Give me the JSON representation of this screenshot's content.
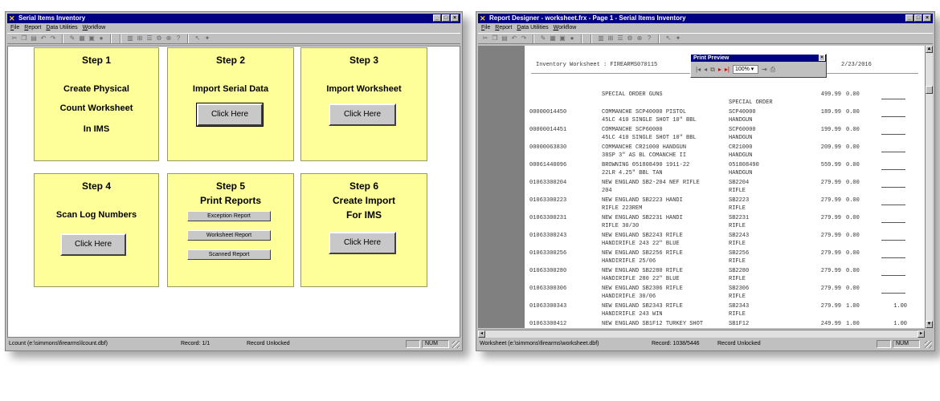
{
  "left_window": {
    "title": "Serial Items Inventory",
    "menu": [
      "File",
      "Report",
      "Data Utilities",
      "Workflow"
    ],
    "steps": [
      {
        "label": "Step 1",
        "lines": [
          "Create Physical",
          "Count Worksheet",
          "In IMS"
        ]
      },
      {
        "label": "Step 2",
        "lines": [
          "Import Serial Data"
        ],
        "button": "Click Here"
      },
      {
        "label": "Step 3",
        "lines": [
          "Import Worksheet"
        ],
        "button": "Click Here"
      },
      {
        "label": "Step 4",
        "lines": [
          "Scan Log Numbers"
        ],
        "button": "Click Here"
      },
      {
        "label": "Step 5",
        "lines": [
          "Print Reports"
        ],
        "buttons": [
          "Exception Report",
          "Worksheet Report",
          "Scanned Report"
        ]
      },
      {
        "label": "Step 6",
        "lines": [
          "Create Import",
          "For IMS"
        ],
        "button": "Click Here"
      }
    ],
    "status": {
      "file": "Lcount (e:\\simmons\\firearms\\lcount.dbf)",
      "record": "Record: 1/1",
      "lock": "Record Unlocked",
      "num": "NUM"
    }
  },
  "right_window": {
    "title": "Report Designer - worksheet.frx - Page 1 - Serial Items Inventory",
    "menu": [
      "File",
      "Report",
      "Data Utilities",
      "Workflow"
    ],
    "report": {
      "title": "Inventory Worksheet :  FIREARMS070115",
      "date": "2/23/2016",
      "section": "SPECIAL ORDER GUNS",
      "section_price": "499.99",
      "section_qty": "0.00",
      "section_cat": "SPECIAL ORDER",
      "rows": [
        {
          "item": "00000014450",
          "d1": "COMMANCHE SCP40000 PISTOL",
          "d2": "45LC 410 SINGLE SHOT 10\" BBL",
          "code": "SCP40000",
          "cat": "HANDGUN",
          "price": "189.99",
          "qty": "0.00",
          "count": ""
        },
        {
          "item": "00000014451",
          "d1": "COMMANCHE SCP60000",
          "d2": "45LC 410 SINGLE SHOT 10\" BBL",
          "code": "SCP60000",
          "cat": "HANDGUN",
          "price": "199.99",
          "qty": "0.00",
          "count": ""
        },
        {
          "item": "00000063830",
          "d1": "COMMANCHE CR21000 HANDGUN",
          "d2": "38SP 3\" AS BL COMANCHE II",
          "code": "CR21000",
          "cat": "HANDGUN",
          "price": "209.99",
          "qty": "0.00",
          "count": ""
        },
        {
          "item": "00061440096",
          "d1": "BROWNING 051808490 1911-22",
          "d2": "22LR 4.25\" BBL TAN",
          "code": "051808490",
          "cat": "HANDGUN",
          "price": "559.99",
          "qty": "0.00",
          "count": ""
        },
        {
          "item": "01063300204",
          "d1": "NEW ENGLAND SB2-204 NEF RIFLE",
          "d2": "204",
          "code": "SB2204",
          "cat": "RIFLE",
          "price": "279.99",
          "qty": "0.00",
          "count": ""
        },
        {
          "item": "01063300223",
          "d1": "NEW ENGLAND SB2223 HANDI",
          "d2": "RIFLE 223REM",
          "code": "SB2223",
          "cat": "RIFLE",
          "price": "279.99",
          "qty": "0.00",
          "count": ""
        },
        {
          "item": "01063300231",
          "d1": "NEW ENGLAND SB2231 HANDI",
          "d2": "RIFLE 30/30",
          "code": "SB2231",
          "cat": "RIFLE",
          "price": "279.99",
          "qty": "0.00",
          "count": ""
        },
        {
          "item": "01063300243",
          "d1": "NEW ENGLAND SB2243 RIFLE",
          "d2": "HANDIRIFLE 243 22\" BLUE",
          "code": "SB2243",
          "cat": "RIFLE",
          "price": "279.99",
          "qty": "0.00",
          "count": ""
        },
        {
          "item": "01063300256",
          "d1": "NEW ENGLAND SB2256 RIFLE",
          "d2": "HANDIRIFLE 25/06",
          "code": "SB2256",
          "cat": "RIFLE",
          "price": "279.99",
          "qty": "0.00",
          "count": ""
        },
        {
          "item": "01063300280",
          "d1": "NEW ENGLAND SB2280 RIFLE",
          "d2": "HANDIRIFLE 280 22\" BLUE",
          "code": "SB2280",
          "cat": "RIFLE",
          "price": "279.99",
          "qty": "0.00",
          "count": ""
        },
        {
          "item": "01063300306",
          "d1": "NEW ENGLAND SB2306 RIFLE",
          "d2": "HANDIRIFLE 30/06",
          "code": "SB2306",
          "cat": "RIFLE",
          "price": "279.99",
          "qty": "0.00",
          "count": ""
        },
        {
          "item": "01063300343",
          "d1": "NEW ENGLAND SB2343 RIFLE",
          "d2": "HANDIRIFLE 243 WIN",
          "code": "SB2343",
          "cat": "RIFLE",
          "price": "279.99",
          "qty": "1.00",
          "count": "1.00"
        },
        {
          "item": "01063300412",
          "d1": "NEW ENGLAND SB1F12 TURKEY SHOT",
          "d2": "",
          "code": "SB1F12",
          "cat": "",
          "price": "249.99",
          "qty": "1.00",
          "count": "1.00"
        }
      ]
    },
    "print_preview": {
      "title": "Print Preview",
      "zoom": "100%"
    },
    "status": {
      "file": "Worksheet (e:\\simmons\\firearms\\worksheet.dbf)",
      "record": "Record: 1038/5446",
      "lock": "Record Unlocked",
      "num": "NUM"
    }
  }
}
